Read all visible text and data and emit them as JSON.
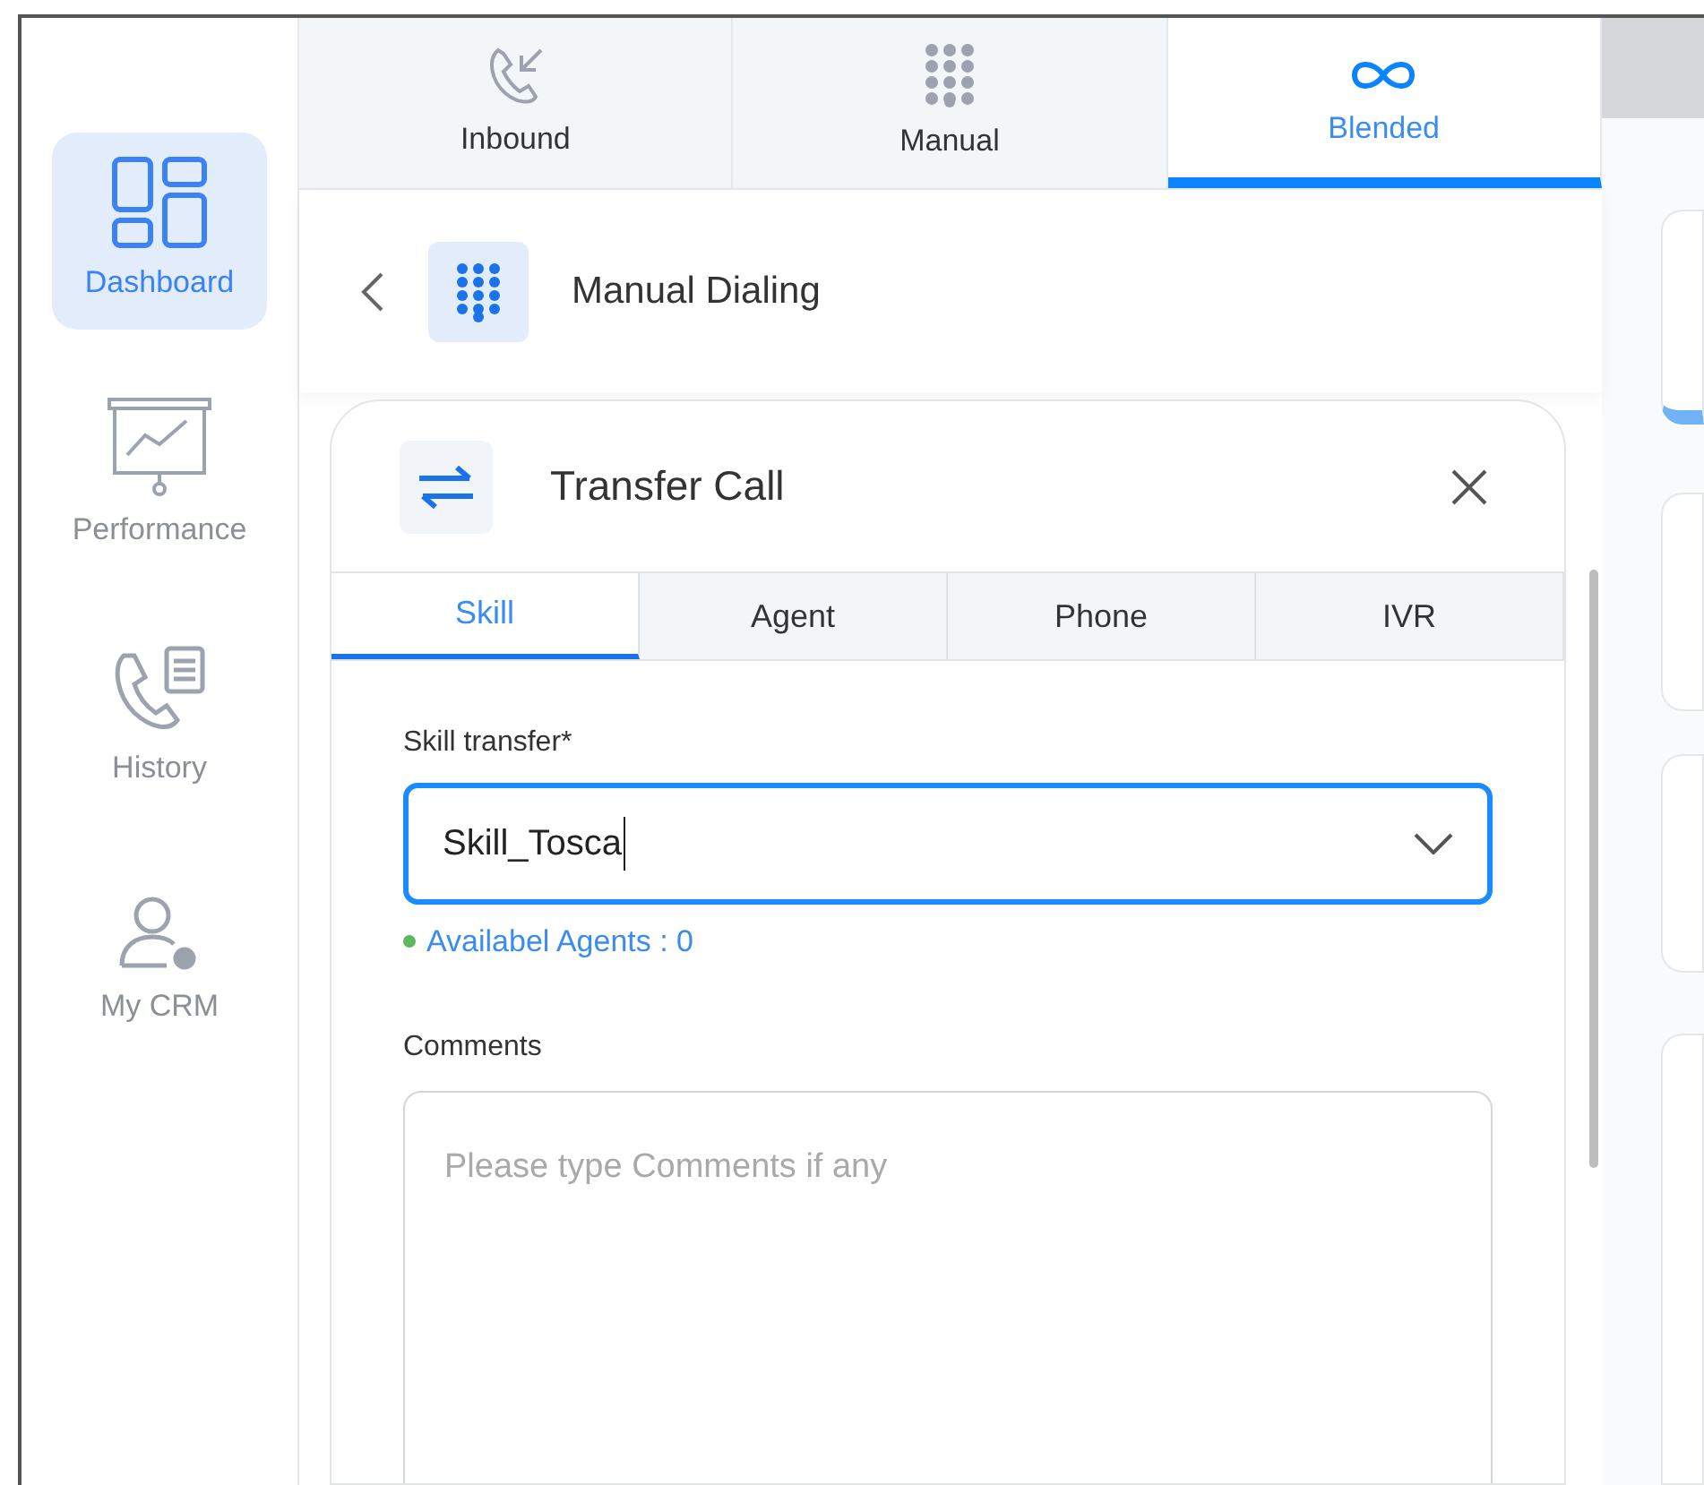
{
  "sidebar": {
    "items": [
      {
        "label": "Dashboard",
        "selected": true
      },
      {
        "label": "Performance",
        "selected": false
      },
      {
        "label": "History",
        "selected": false
      },
      {
        "label": "My CRM",
        "selected": false
      }
    ]
  },
  "mode_tabs": [
    {
      "label": "Inbound",
      "selected": false
    },
    {
      "label": "Manual",
      "selected": false
    },
    {
      "label": "Blended",
      "selected": true
    }
  ],
  "header": {
    "title": "Manual Dialing"
  },
  "transfer_panel": {
    "title": "Transfer Call",
    "tabs": [
      {
        "label": "Skill",
        "selected": true
      },
      {
        "label": "Agent",
        "selected": false
      },
      {
        "label": "Phone",
        "selected": false
      },
      {
        "label": "IVR",
        "selected": false
      }
    ],
    "skill_field": {
      "label": "Skill transfer*",
      "value": "Skill_Tosca",
      "focused": true
    },
    "available_agents": "Availabel Agents : 0",
    "comments": {
      "label": "Comments",
      "placeholder": "Please type Comments if any"
    }
  }
}
